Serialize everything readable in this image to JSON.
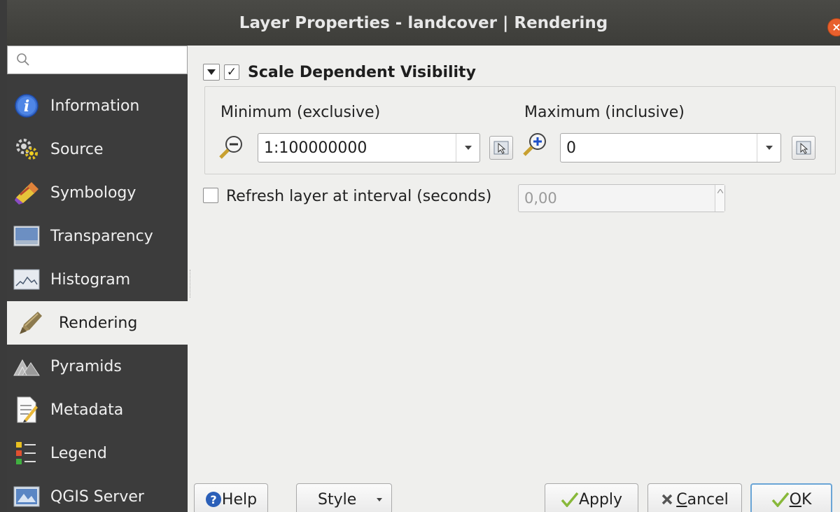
{
  "window": {
    "title": "Layer Properties - landcover | Rendering",
    "close_glyph": "×"
  },
  "search": {
    "placeholder": ""
  },
  "sidebar": {
    "items": [
      {
        "label": "Information",
        "icon": "information-icon"
      },
      {
        "label": "Source",
        "icon": "source-icon"
      },
      {
        "label": "Symbology",
        "icon": "symbology-icon"
      },
      {
        "label": "Transparency",
        "icon": "transparency-icon"
      },
      {
        "label": "Histogram",
        "icon": "histogram-icon"
      },
      {
        "label": "Rendering",
        "icon": "rendering-icon",
        "active": true
      },
      {
        "label": "Pyramids",
        "icon": "pyramids-icon"
      },
      {
        "label": "Metadata",
        "icon": "metadata-icon"
      },
      {
        "label": "Legend",
        "icon": "legend-icon"
      },
      {
        "label": "QGIS Server",
        "icon": "qgis-server-icon"
      }
    ]
  },
  "scale_group": {
    "title": "Scale Dependent Visibility",
    "enabled_mark": "✓",
    "min_label": "Minimum (exclusive)",
    "min_value": "1:100000000",
    "max_label": "Maximum (inclusive)",
    "max_value": "0"
  },
  "refresh": {
    "label": "Refresh layer at interval (seconds)",
    "value": "0,00",
    "checked": false
  },
  "buttons": {
    "help": "Help",
    "style": "Style",
    "apply": "Apply",
    "cancel_prefix": "",
    "cancel_mnemonic": "C",
    "cancel_rest": "ancel",
    "ok_mnemonic": "O",
    "ok_rest": "K"
  },
  "colors": {
    "sidebar_bg": "#3c3c3c",
    "panel_bg": "#efefed",
    "selected_item_bg": "#efefed",
    "close_button": "#e8602d",
    "ok_focus_border": "#6aa5d6"
  }
}
